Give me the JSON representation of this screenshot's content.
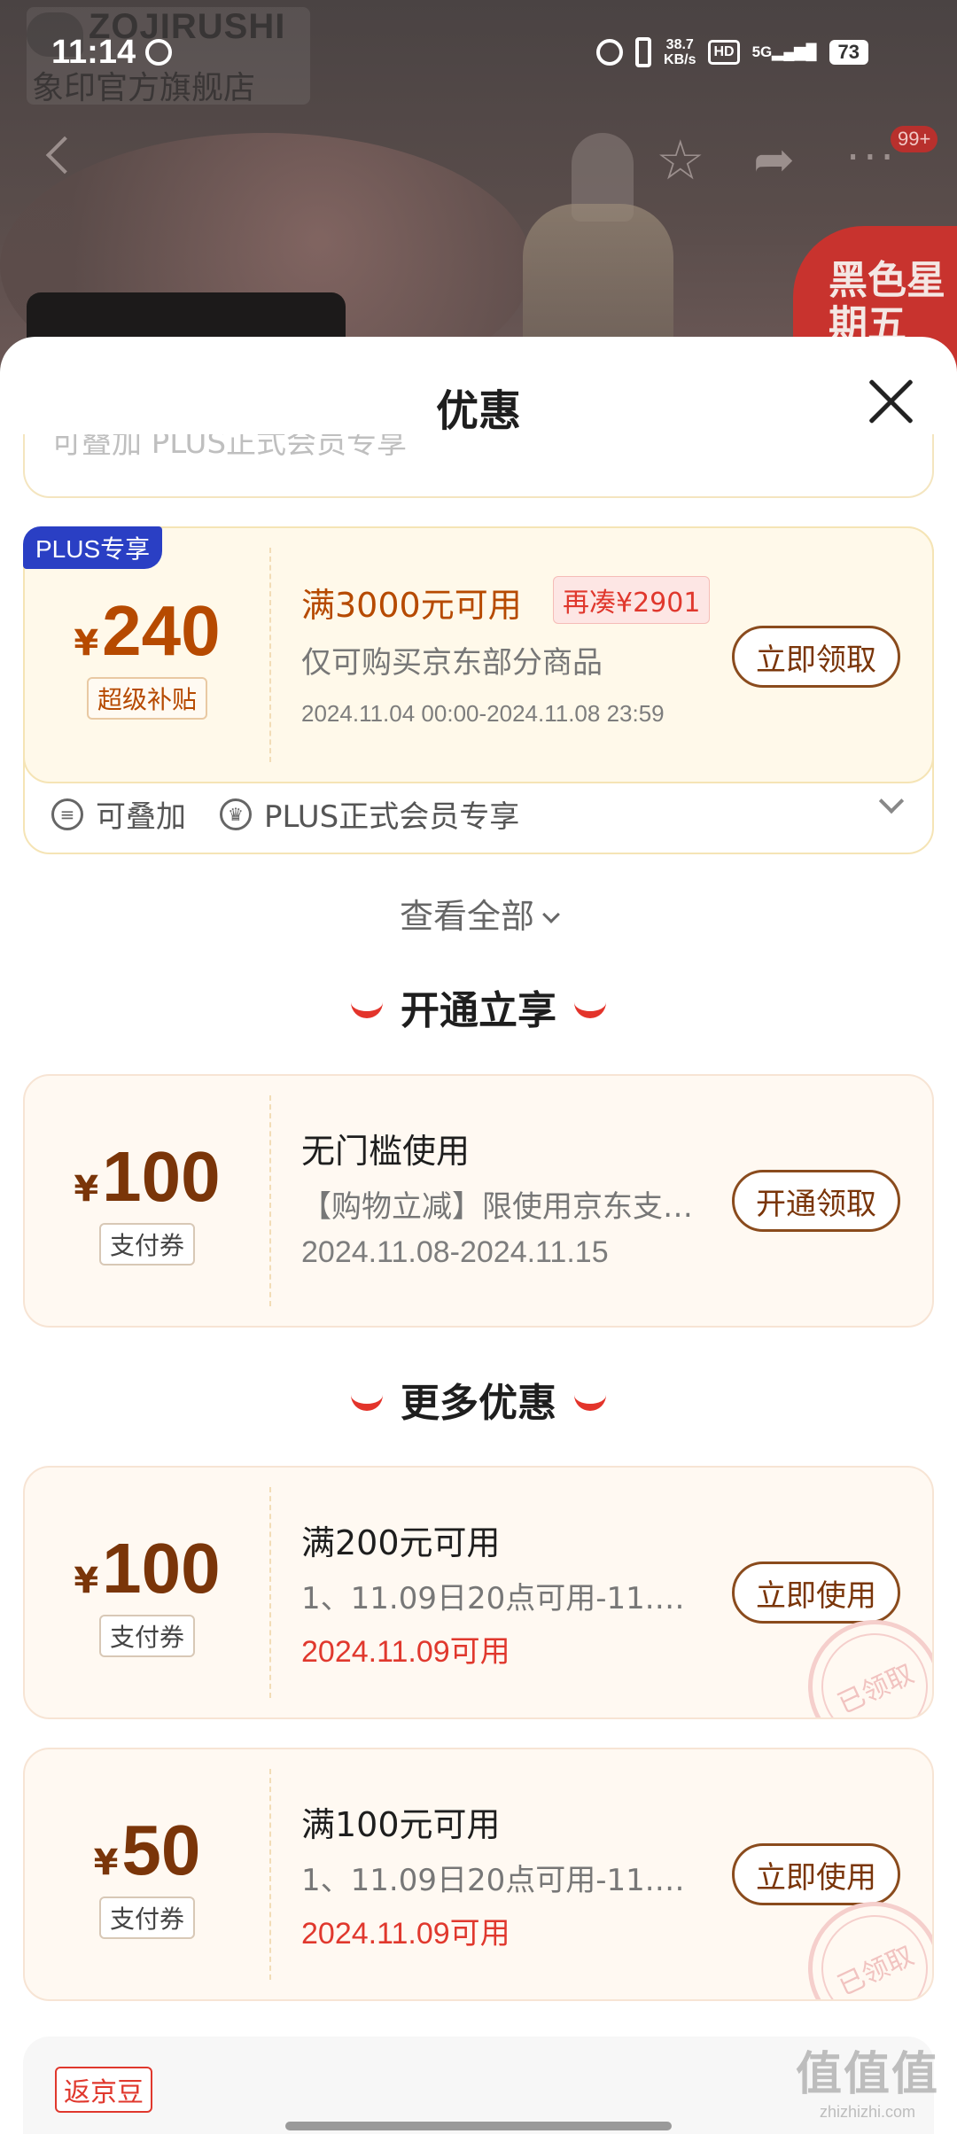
{
  "status": {
    "time": "11:14",
    "speed_top": "38.7",
    "speed_unit": "KB/s",
    "hd": "HD",
    "network": "5G",
    "battery": "73"
  },
  "bg": {
    "brand_en": "ZOJIRUSHI",
    "brand_cn": "象印官方旗舰店",
    "nav_badge": "99+",
    "promo": "黑色星期五"
  },
  "sheet": {
    "title": "优惠",
    "peek_text": "可叠加   PLUS正式会员专享",
    "plus_coupon": {
      "tag": "PLUS专享",
      "yen": "¥",
      "amount": "240",
      "sub": "超级补贴",
      "title": "满3000元可用",
      "need": "再凑¥2901",
      "desc": "仅可购买京东部分商品",
      "date": "2024.11.04 00:00-2024.11.08 23:59",
      "button": "立即领取",
      "stack_label": "可叠加",
      "member_label": "PLUS正式会员专享"
    },
    "view_all": "查看全部",
    "section1": "开通立享",
    "coupon1": {
      "yen": "¥",
      "amount": "100",
      "sub": "支付券",
      "title": "无门槛使用",
      "desc": "【购物立减】限使用京东支…",
      "date": "2024.11.08-2024.11.15",
      "button": "开通领取"
    },
    "section2": "更多优惠",
    "coupon2": {
      "yen": "¥",
      "amount": "100",
      "sub": "支付券",
      "title": "满200元可用",
      "desc": "1、11.09日20点可用-11.11…",
      "date": "2024.11.09可用",
      "button": "立即使用",
      "stamp": "已领取"
    },
    "coupon3": {
      "yen": "¥",
      "amount": "50",
      "sub": "支付券",
      "title": "满100元可用",
      "desc": "1、11.09日20点可用-11.11…",
      "date": "2024.11.09可用",
      "button": "立即使用",
      "stamp": "已领取"
    },
    "bottom_tag": "返京豆"
  },
  "watermark": {
    "cn": "值值值",
    "en": "zhizhizhi.com"
  }
}
